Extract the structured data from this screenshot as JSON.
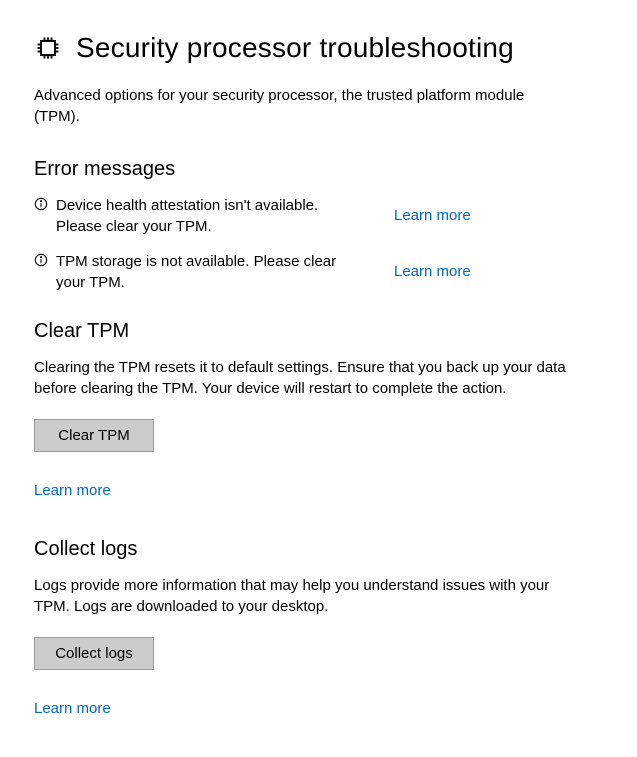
{
  "header": {
    "title": "Security processor troubleshooting",
    "subheading": "Advanced options for your security processor, the trusted platform module (TPM)."
  },
  "errors": {
    "section_title": "Error messages",
    "items": [
      {
        "text": "Device health attestation isn't available. Please clear your TPM.",
        "link": "Learn more"
      },
      {
        "text": "TPM storage is not available. Please clear your TPM.",
        "link": "Learn more"
      }
    ]
  },
  "clear_tpm": {
    "section_title": "Clear TPM",
    "description": "Clearing the TPM resets it to default settings. Ensure that you back up your data before clearing the TPM. Your device will restart to complete the action.",
    "button": "Clear TPM",
    "learn_more": "Learn more"
  },
  "collect_logs": {
    "section_title": "Collect logs",
    "description": "Logs provide more information that may help you understand issues with your TPM.  Logs are downloaded to your desktop.",
    "button": "Collect logs",
    "learn_more": "Learn more"
  }
}
